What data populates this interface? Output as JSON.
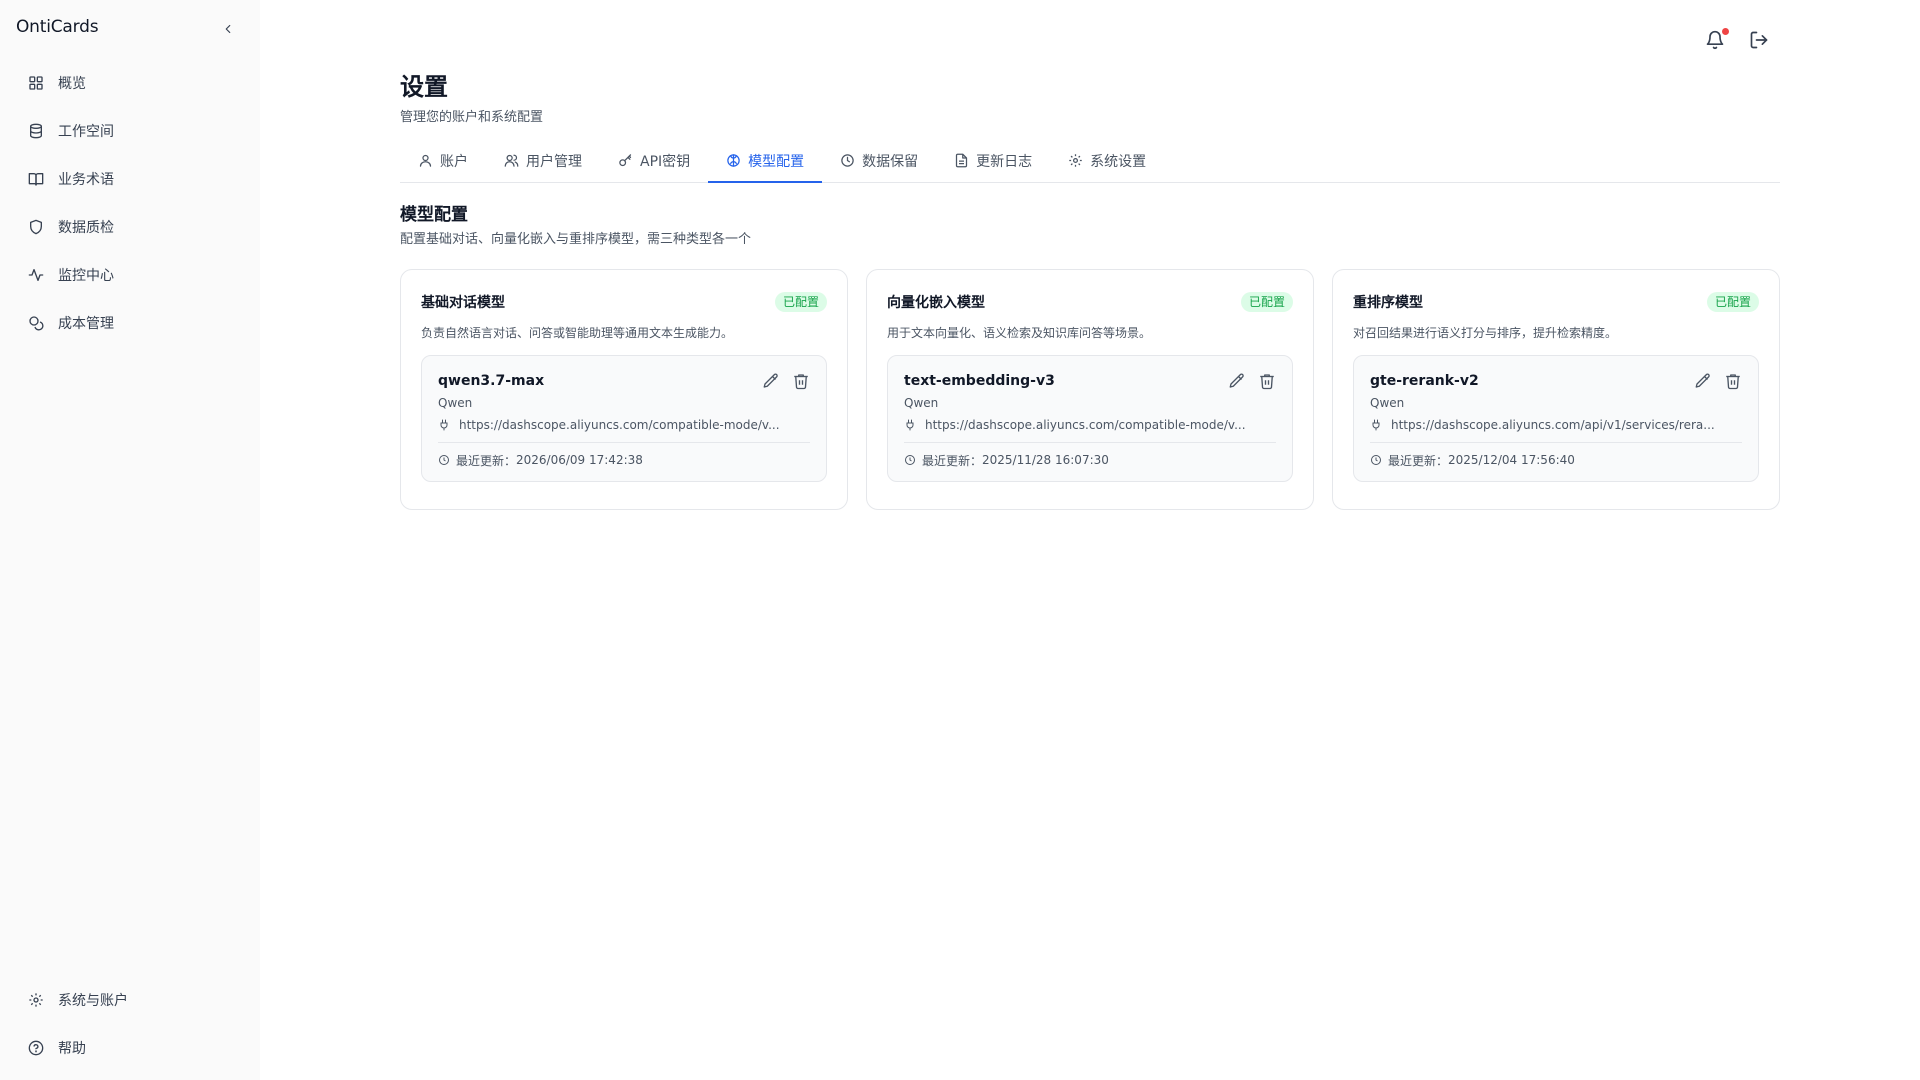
{
  "app": {
    "name": "OntiCards"
  },
  "sidebar": {
    "items": [
      {
        "label": "概览",
        "icon": "dashboard-icon"
      },
      {
        "label": "工作空间",
        "icon": "database-icon"
      },
      {
        "label": "业务术语",
        "icon": "book-icon"
      },
      {
        "label": "数据质检",
        "icon": "shield-icon"
      },
      {
        "label": "监控中心",
        "icon": "activity-icon"
      },
      {
        "label": "成本管理",
        "icon": "coins-icon"
      }
    ],
    "bottom": [
      {
        "label": "系统与账户",
        "icon": "gear-icon"
      },
      {
        "label": "帮助",
        "icon": "help-icon"
      }
    ]
  },
  "page": {
    "title": "设置",
    "subtitle": "管理您的账户和系统配置"
  },
  "tabs": [
    {
      "label": "账户",
      "icon": "user-icon",
      "active": false
    },
    {
      "label": "用户管理",
      "icon": "users-icon",
      "active": false
    },
    {
      "label": "API密钥",
      "icon": "key-icon",
      "active": false
    },
    {
      "label": "模型配置",
      "icon": "brain-icon",
      "active": true
    },
    {
      "label": "数据保留",
      "icon": "clock-icon",
      "active": false
    },
    {
      "label": "更新日志",
      "icon": "file-icon",
      "active": false
    },
    {
      "label": "系统设置",
      "icon": "gear-icon",
      "active": false
    }
  ],
  "section": {
    "title": "模型配置",
    "desc": "配置基础对话、向量化嵌入与重排序模型，需三种类型各一个"
  },
  "update_label": "最近更新：",
  "cards": [
    {
      "title": "基础对话模型",
      "status": "已配置",
      "desc": "负责自然语言对话、问答或智能助理等通用文本生成能力。",
      "model": "qwen3.7-max",
      "provider": "Qwen",
      "endpoint": "https://dashscope.aliyuncs.com/compatible-mode/v...",
      "updated": "2026/06/09 17:42:38"
    },
    {
      "title": "向量化嵌入模型",
      "status": "已配置",
      "desc": "用于文本向量化、语义检索及知识库问答等场景。",
      "model": "text-embedding-v3",
      "provider": "Qwen",
      "endpoint": "https://dashscope.aliyuncs.com/compatible-mode/v...",
      "updated": "2025/11/28 16:07:30"
    },
    {
      "title": "重排序模型",
      "status": "已配置",
      "desc": "对召回结果进行语义打分与排序，提升检索精度。",
      "model": "gte-rerank-v2",
      "provider": "Qwen",
      "endpoint": "https://dashscope.aliyuncs.com/api/v1/services/rera...",
      "updated": "2025/12/04 17:56:40"
    }
  ],
  "colors": {
    "accent": "#2563eb",
    "success": "#16a34a",
    "success_bg": "#dcfce7",
    "notification": "#ef4444"
  }
}
